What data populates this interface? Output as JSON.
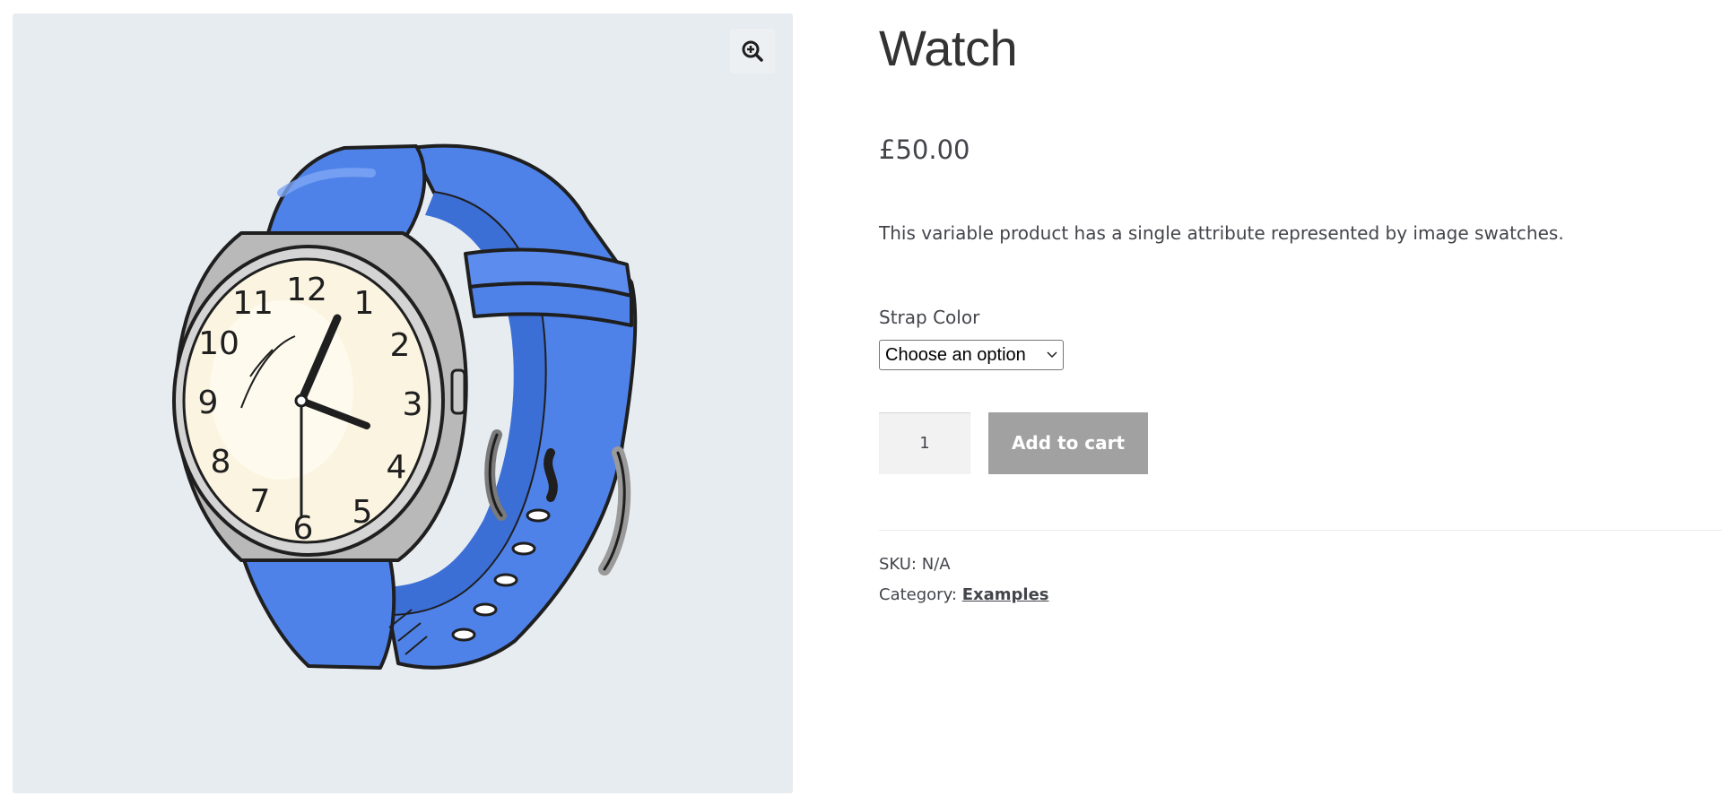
{
  "product": {
    "title": "Watch",
    "price": "£50.00",
    "description": "This variable product has a single attribute represented by image swatches.",
    "attribute_label": "Strap Color",
    "attribute_select_value": "Choose an option",
    "quantity": "1",
    "add_to_cart_label": "Add to cart",
    "sku_label": "SKU:",
    "sku_value": "N/A",
    "category_label": "Category:",
    "category_value": "Examples"
  },
  "gallery": {
    "zoom_icon": "zoom-in-icon",
    "image_icon": "watch-icon",
    "watch_numerals": [
      "12",
      "1",
      "2",
      "3",
      "4",
      "5",
      "6",
      "7",
      "8",
      "9",
      "10",
      "11"
    ]
  },
  "colors": {
    "gallery_bg": "#e7ecf1",
    "strap_blue": "#4f82e8",
    "button_disabled": "#a1a1a1",
    "dial": "#faf4e0"
  }
}
